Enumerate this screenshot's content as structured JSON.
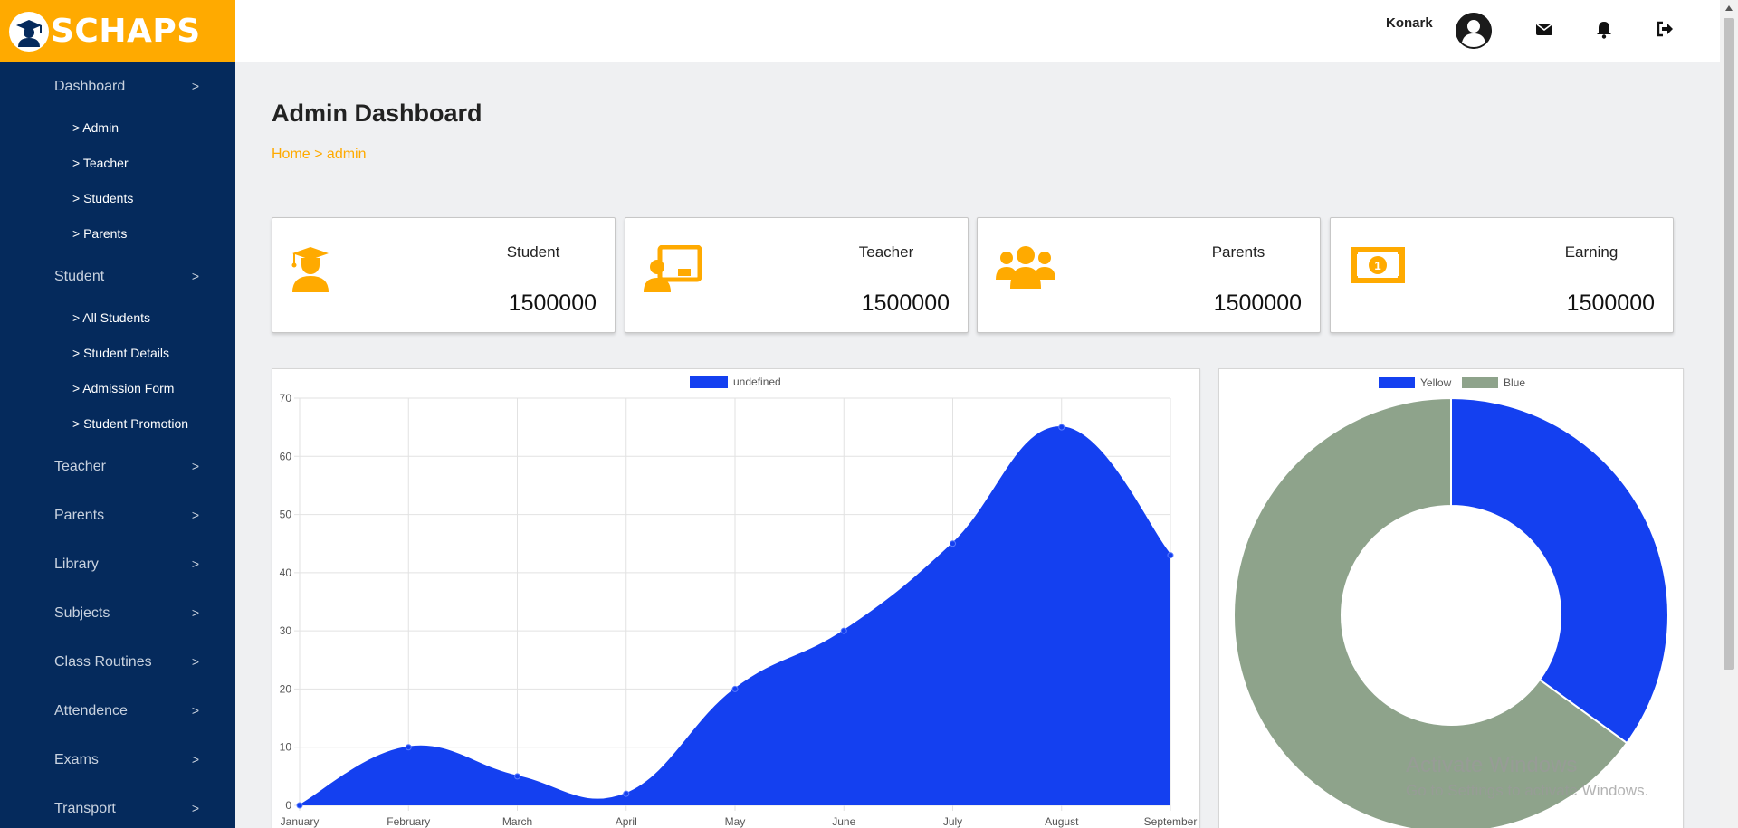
{
  "brand": {
    "name": "SCHAPS",
    "color": "#ffaa00",
    "icon": "graduate-icon"
  },
  "sidebar": {
    "bg": "#052a5c",
    "sections": [
      {
        "label": "Dashboard",
        "arrow": ">",
        "children": [
          "> Admin",
          "> Teacher",
          "> Students",
          "> Parents"
        ]
      },
      {
        "label": "Student",
        "arrow": ">",
        "children": [
          "> All Students",
          "> Student Details",
          "> Admission Form",
          "> Student Promotion"
        ]
      },
      {
        "label": "Teacher",
        "arrow": ">",
        "children": []
      },
      {
        "label": "Parents",
        "arrow": ">",
        "children": []
      },
      {
        "label": "Library",
        "arrow": ">",
        "children": []
      },
      {
        "label": "Subjects",
        "arrow": ">",
        "children": []
      },
      {
        "label": "Class Routines",
        "arrow": ">",
        "children": []
      },
      {
        "label": "Attendence",
        "arrow": ">",
        "children": []
      },
      {
        "label": "Exams",
        "arrow": ">",
        "children": []
      },
      {
        "label": "Transport",
        "arrow": ">",
        "children": []
      }
    ]
  },
  "topbar": {
    "user_name": "Konark",
    "icons": [
      "user-avatar-icon",
      "mail-icon",
      "bell-icon",
      "logout-icon"
    ]
  },
  "page": {
    "title": "Admin Dashboard",
    "breadcrumb": "Home > admin"
  },
  "stats": [
    {
      "label": "Student",
      "value": "1500000",
      "icon": "graduate-icon"
    },
    {
      "label": "Teacher",
      "value": "1500000",
      "icon": "teacher-board-icon"
    },
    {
      "label": "Parents",
      "value": "1500000",
      "icon": "users-group-icon"
    },
    {
      "label": "Earning",
      "value": "1500000",
      "icon": "money-bill-icon"
    }
  ],
  "chart_data": [
    {
      "type": "area",
      "categories": [
        "January",
        "February",
        "March",
        "April",
        "May",
        "June",
        "July",
        "August",
        "September"
      ],
      "series": [
        {
          "name": "undefined",
          "values": [
            0,
            10,
            5,
            2,
            20,
            30,
            45,
            65,
            43
          ],
          "color": "#1440f0"
        }
      ],
      "ylim": [
        0,
        70
      ],
      "yticks": [
        0,
        10,
        20,
        30,
        40,
        50,
        60,
        70
      ],
      "grid": true,
      "legend": "top-center"
    },
    {
      "type": "pie",
      "donut": true,
      "labels": [
        "Yellow",
        "Blue"
      ],
      "values": [
        35,
        65
      ],
      "colors": [
        "#1440f0",
        "#8ea38b"
      ],
      "legend": "top-center"
    }
  ],
  "watermark": {
    "line1": "Activate Windows",
    "line2": "Go to Settings to activate Windows."
  }
}
